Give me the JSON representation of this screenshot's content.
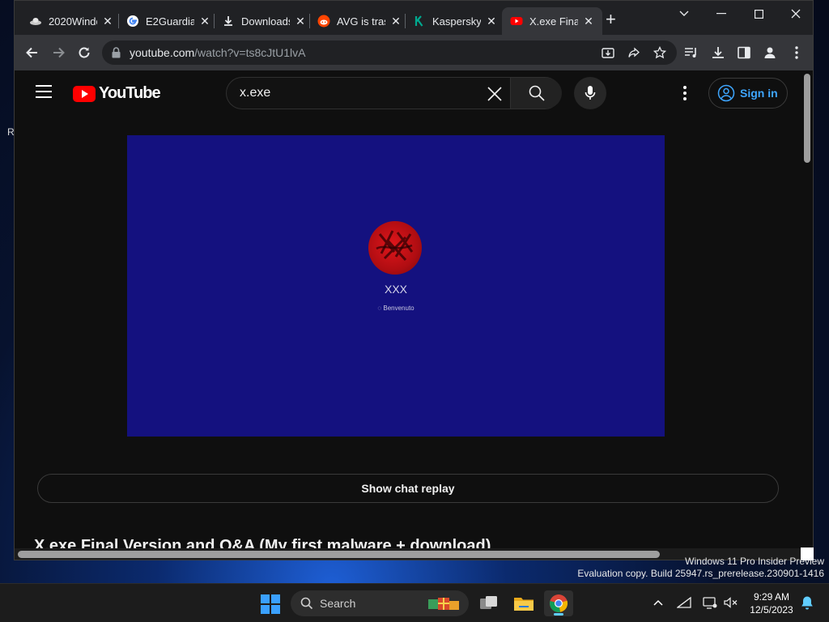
{
  "browser": {
    "tabs": [
      {
        "label": "2020Windows",
        "icon": "ufo-icon"
      },
      {
        "label": "E2Guardian",
        "icon": "google-icon"
      },
      {
        "label": "Downloads",
        "icon": "download-icon"
      },
      {
        "label": "AVG is trash",
        "icon": "reddit-icon"
      },
      {
        "label": "Kaspersky",
        "icon": "kaspersky-icon"
      },
      {
        "label": "X.exe Final",
        "icon": "youtube-icon"
      }
    ],
    "url_host": "youtube.com",
    "url_path": "/watch?v=ts8cJtU1lvA"
  },
  "youtube": {
    "logo_text": "YouTube",
    "search_value": "x.exe",
    "signin_label": "Sign in",
    "player": {
      "channel_name": "XXX",
      "status_text": "Benvenuto"
    },
    "chat_replay_label": "Show chat replay",
    "video_title": "X.exe Final Version and Q&A (My first malware + download)"
  },
  "desktop": {
    "letter": "R",
    "watermark_line1": "Windows 11 Pro Insider Preview",
    "watermark_line2": "Evaluation copy. Build 25947.rs_prerelease.230901-1416"
  },
  "taskbar": {
    "search_label": "Search",
    "time": "9:29 AM",
    "date": "12/5/2023"
  },
  "colors": {
    "youtube_red": "#ff0000",
    "player_bg": "#14117f",
    "link_blue": "#3ea6ff",
    "taskbar_accent": "#60cdff"
  }
}
